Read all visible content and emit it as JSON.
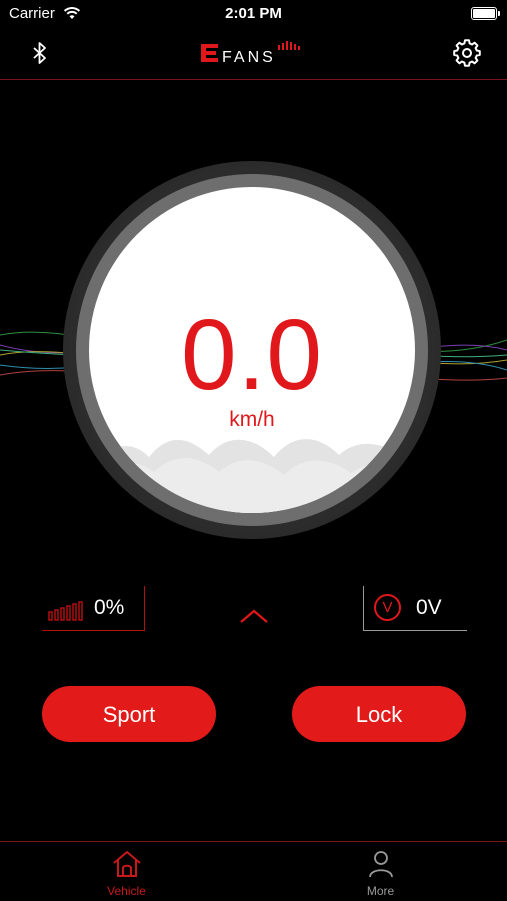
{
  "status_bar": {
    "carrier": "Carrier",
    "time": "2:01 PM"
  },
  "header": {
    "logo_text": "EFANS",
    "bluetooth_icon": "bluetooth-icon",
    "settings_icon": "gear-icon"
  },
  "speedometer": {
    "speed": "0.0",
    "unit": "km/h"
  },
  "stats": {
    "battery_percent": "0%",
    "battery_level": 0,
    "voltage_symbol": "V",
    "voltage": "0V"
  },
  "buttons": {
    "sport": "Sport",
    "lock": "Lock"
  },
  "tabs": [
    {
      "label": "Vehicle",
      "icon": "home-icon",
      "active": true
    },
    {
      "label": "More",
      "icon": "person-icon",
      "active": false
    }
  ],
  "colors": {
    "accent": "#e21a1a",
    "background": "#000000",
    "inactive": "#9a9a9a"
  }
}
